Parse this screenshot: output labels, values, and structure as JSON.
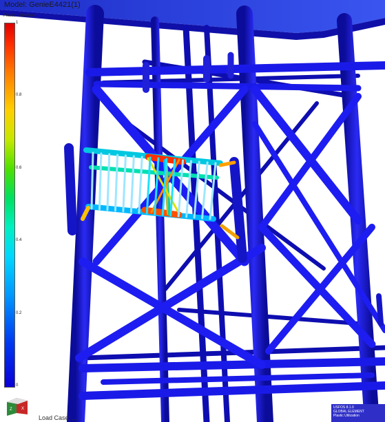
{
  "window": {
    "title": "Model: GenieE4421(1)"
  },
  "legend": {
    "title": "Plastic Utilization",
    "ticks": [
      "1",
      "0.8",
      "0.6",
      "0.4",
      "0.2",
      "0"
    ],
    "colors": {
      "low": "#0a00d8",
      "mid": "#00e060",
      "high": "#e00000"
    }
  },
  "axis_triad": {
    "x_label": "Z",
    "y_label": "X"
  },
  "footer": {
    "load_case": "Load Case: ..."
  },
  "info_box": {
    "version": "USFOS 8.1.0",
    "line1": "GLOBAL ELEMENT",
    "line2": "Plastic Utilization"
  },
  "colors": {
    "structure": "#1818e0",
    "structure_dark": "#0c0c9a",
    "deck": "#2a40e8",
    "background": "#ffffff"
  }
}
